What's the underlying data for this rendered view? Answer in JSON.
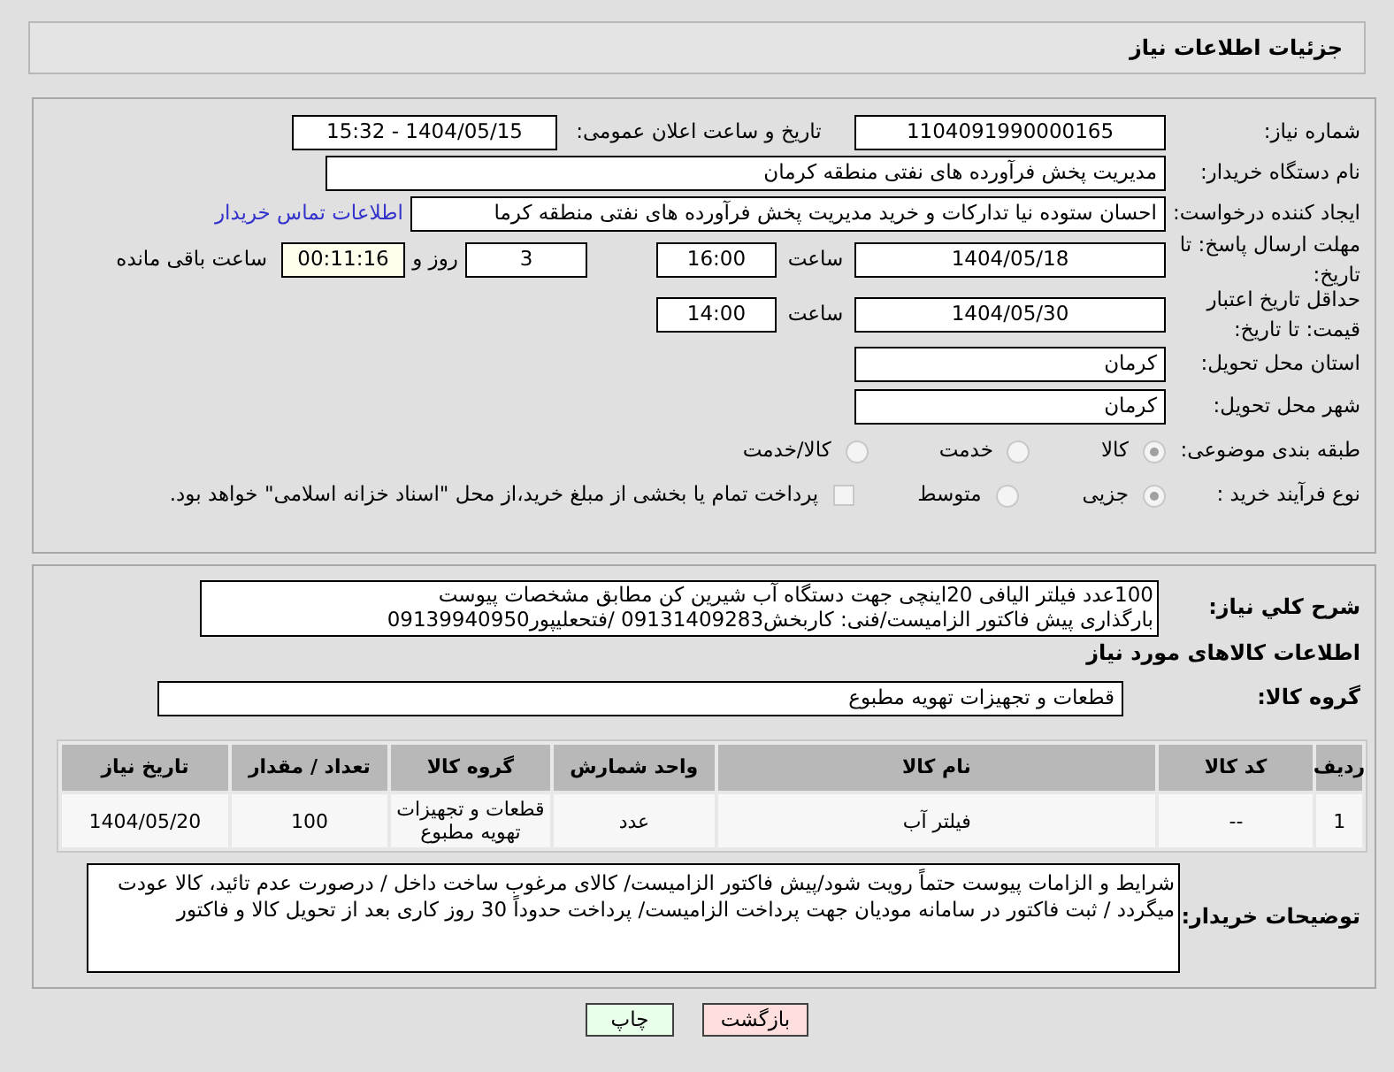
{
  "page_title": "جزئیات اطلاعات نیاز",
  "need_number": {
    "label": "شماره نیاز:",
    "value": "1104091990000165"
  },
  "announce": {
    "label": "تاریخ و ساعت اعلان عمومی:",
    "value": "1404/05/15 - 15:32"
  },
  "buyer": {
    "label": "نام دستگاه خریدار:",
    "value": "مدیریت پخش فرآورده های نفتی منطقه کرمان"
  },
  "creator": {
    "label": "ایجاد کننده درخواست:",
    "value": "احسان  ستوده نیا  تدارکات و خرید  مدیریت پخش فرآورده های نفتی منطقه کرما",
    "link": "اطلاعات تماس خریدار"
  },
  "deadline": {
    "label": "مهلت ارسال پاسخ: تا تاریخ:",
    "date": "1404/05/18",
    "time_label": "ساعت",
    "time": "16:00",
    "days": "3",
    "days_label": "روز و",
    "remaining": "00:11:16",
    "remaining_label": "ساعت باقی مانده"
  },
  "validity": {
    "label": "حداقل تاریخ اعتبار قیمت: تا تاریخ:",
    "date": "1404/05/30",
    "time_label": "ساعت",
    "time": "14:00"
  },
  "province": {
    "label": "استان محل تحویل:",
    "value": "کرمان"
  },
  "city": {
    "label": "شهر محل تحویل:",
    "value": "کرمان"
  },
  "category": {
    "label": "طبقه بندی موضوعی:",
    "options": [
      {
        "label": "کالا",
        "selected": true
      },
      {
        "label": "خدمت",
        "selected": false
      },
      {
        "label": "کالا/خدمت",
        "selected": false
      }
    ]
  },
  "process": {
    "label": "نوع فرآیند خرید :",
    "options": [
      {
        "label": "جزیی",
        "selected": true
      },
      {
        "label": "متوسط",
        "selected": false
      }
    ],
    "treasury": {
      "label": "پرداخت تمام یا بخشی از مبلغ خرید،از محل \"اسناد خزانه اسلامی\" خواهد بود.",
      "checked": false
    }
  },
  "description": {
    "label": "شرح کلي نياز:",
    "lines": [
      "100عدد فیلتر الیافی 20اینچی جهت دستگاه آب شیرین کن مطابق مشخصات پیوست",
      "بارگذاری پیش فاکتور الزامیست/فنی: کاربخش09131409283 /فتحعلیپور09139940950"
    ]
  },
  "goods_title": "اطلاعات کالاهای مورد نیاز",
  "goods_group": {
    "label": "گروه کالا:",
    "value": "قطعات و تجهیزات تهویه مطبوع"
  },
  "table": {
    "columns": [
      "ردیف",
      "کد کالا",
      "نام کالا",
      "واحد شمارش",
      "گروه کالا",
      "تعداد / مقدار",
      "تاریخ نیاز"
    ],
    "rows": [
      [
        "1",
        "--",
        "فیلتر آب",
        "عدد",
        "قطعات و تجهیزات تهویه مطبوع",
        "100",
        "1404/05/20"
      ]
    ]
  },
  "notes": {
    "label": "توضیحات خریدار:",
    "lines": [
      "شرایط و الزامات پیوست حتماً رویت شود/پیش فاکتور الزامیست/ کالای مرغوب ساخت داخل / درصورت عدم تائید، کالا عودت",
      "میگردد / ثبت فاکتور در سامانه مودیان جهت پرداخت الزامیست/ پرداخت حدوداً 30 روز کاری بعد از تحویل کالا و فاکتور"
    ]
  },
  "buttons": [
    {
      "kind": "back",
      "label": "بازگشت"
    },
    {
      "kind": "print",
      "label": "چاپ"
    }
  ]
}
